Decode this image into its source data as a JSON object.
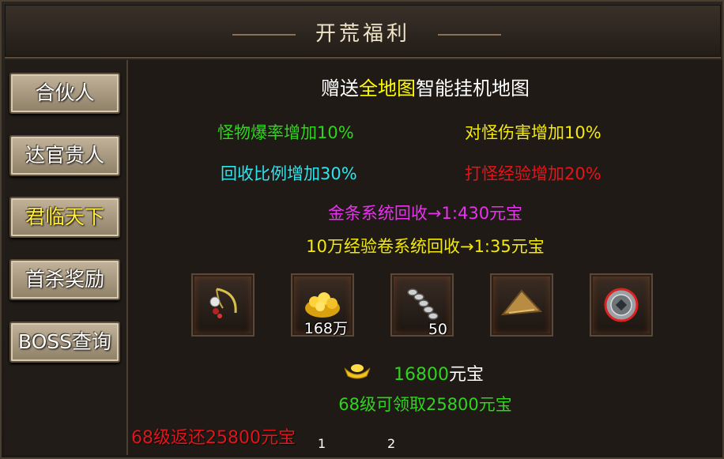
{
  "title": "开荒福利",
  "sidebar": {
    "items": [
      {
        "label": "合伙人"
      },
      {
        "label": "达官贵人"
      },
      {
        "label": "君临天下"
      },
      {
        "label": "首杀奖励"
      },
      {
        "label": "BOSS查询"
      }
    ],
    "active_index": 2
  },
  "main": {
    "headline_prefix": "赠送",
    "headline_highlight": "全地图",
    "headline_suffix": "智能挂机地图",
    "perks": [
      {
        "text": "怪物爆率增加10%",
        "color": "#2fd41f"
      },
      {
        "text": "对怪伤害增加10%",
        "color": "#f3e90c"
      },
      {
        "text": "回收比例增加30%",
        "color": "#2fe3ef"
      },
      {
        "text": "打怪经验增加20%",
        "color": "#e3141a"
      }
    ],
    "recycle_gold": "金条系统回收→1:430元宝",
    "recycle_exp": "10万经验卷系统回收→1:35元宝",
    "items": [
      {
        "icon": "necklace-icon",
        "qty": ""
      },
      {
        "icon": "gold-pile-icon",
        "qty": "168万"
      },
      {
        "icon": "scroll-bundle-icon",
        "qty": "50"
      },
      {
        "icon": "straw-hat-icon",
        "qty": ""
      },
      {
        "icon": "medallion-icon",
        "qty": ""
      }
    ],
    "ingot_amount": "16800",
    "ingot_unit": "元宝",
    "level_reward": "68级可领取25800元宝",
    "bottom_notice": "68级返还25800元宝",
    "pages": [
      "1",
      "2"
    ]
  },
  "colors": {
    "magenta": "#e832ef",
    "yellow": "#f3e90c",
    "green": "#2fd41f",
    "red": "#e3141a"
  }
}
